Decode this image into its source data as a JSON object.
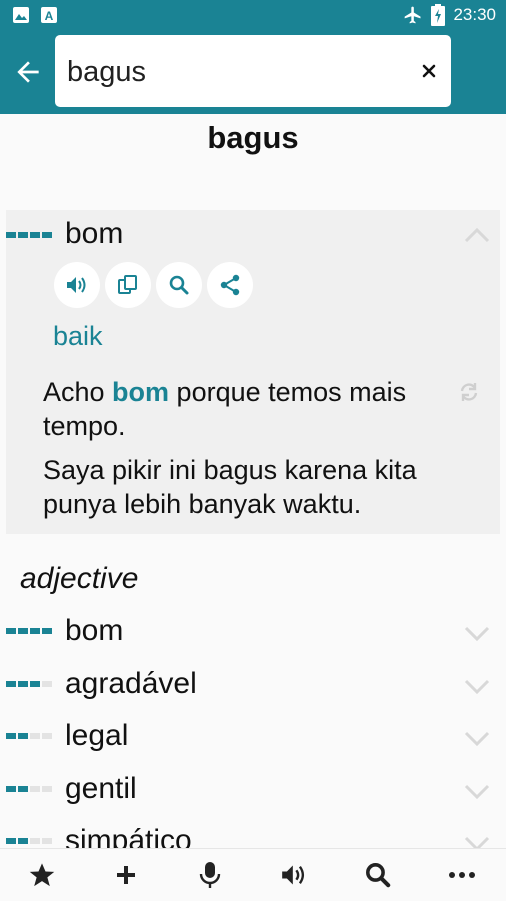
{
  "status_bar": {
    "time": "23:30"
  },
  "search": {
    "value": "bagus"
  },
  "headword": "bagus",
  "expanded_entry": {
    "word": "bom",
    "synonym": "baik",
    "example_before": "Acho ",
    "example_highlight": "bom",
    "example_after": " porque temos mais tempo.",
    "translation": "Saya pikir ini bagus karena kita punya lebih banyak waktu."
  },
  "part_of_speech": "adjective",
  "entries": [
    {
      "word": "bom",
      "frequency": 4
    },
    {
      "word": "agradável",
      "frequency": 3
    },
    {
      "word": "legal",
      "frequency": 2
    },
    {
      "word": "gentil",
      "frequency": 2
    },
    {
      "word": "simpático",
      "frequency": 2
    }
  ],
  "colors": {
    "accent": "#1a8394",
    "background": "#fafafa",
    "expanded_bg": "#f0f0f0"
  },
  "icons": {
    "actions": [
      "speaker-icon",
      "copy-icon",
      "search-icon",
      "share-icon"
    ],
    "bottom_bar": [
      "star-icon",
      "plus-icon",
      "microphone-icon",
      "speaker-icon",
      "search-icon",
      "more-icon"
    ]
  }
}
